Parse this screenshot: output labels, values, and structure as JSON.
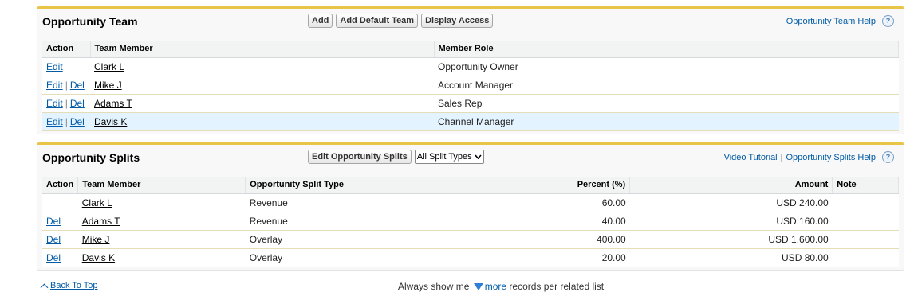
{
  "team": {
    "title": "Opportunity Team",
    "buttons": {
      "add": "Add",
      "add_default": "Add Default Team",
      "display_access": "Display Access"
    },
    "help": "Opportunity Team Help",
    "headers": {
      "action": "Action",
      "member": "Team Member",
      "role": "Member Role"
    },
    "rows": [
      {
        "edit": "Edit",
        "del": "",
        "member": "Clark L",
        "role": "Opportunity Owner"
      },
      {
        "edit": "Edit",
        "del": "Del",
        "member": "Mike J",
        "role": "Account Manager"
      },
      {
        "edit": "Edit",
        "del": "Del",
        "member": "Adams T",
        "role": "Sales Rep"
      },
      {
        "edit": "Edit",
        "del": "Del",
        "member": "Davis K",
        "role": "Channel Manager"
      }
    ]
  },
  "splits": {
    "title": "Opportunity Splits",
    "edit_button": "Edit Opportunity Splits",
    "split_type_select": "All Split Types",
    "video_tutorial": "Video Tutorial",
    "help": "Opportunity Splits Help",
    "headers": {
      "action": "Action",
      "member": "Team Member",
      "type": "Opportunity Split Type",
      "percent": "Percent (%)",
      "amount": "Amount",
      "note": "Note"
    },
    "rows": [
      {
        "del": "",
        "member": "Clark L",
        "type": "Revenue",
        "percent": "60.00",
        "amount": "USD 240.00",
        "note": ""
      },
      {
        "del": "Del",
        "member": "Adams T",
        "type": "Revenue",
        "percent": "40.00",
        "amount": "USD 160.00",
        "note": ""
      },
      {
        "del": "Del",
        "member": "Mike J",
        "type": "Overlay",
        "percent": "400.00",
        "amount": "USD 1,600.00",
        "note": ""
      },
      {
        "del": "Del",
        "member": "Davis K",
        "type": "Overlay",
        "percent": "20.00",
        "amount": "USD 80.00",
        "note": ""
      }
    ]
  },
  "footer": {
    "back_to_top": "Back To Top",
    "always_show": "Always show me",
    "more": "more",
    "records_per": "records per related list"
  },
  "colors": {
    "accent": "#e8c547",
    "link": "#015ba7",
    "highlight_row": "#e3f3ff"
  }
}
